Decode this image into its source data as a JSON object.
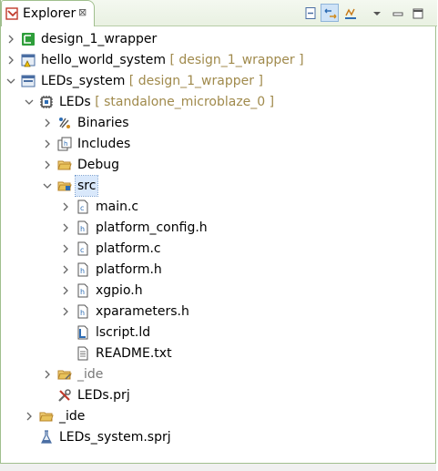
{
  "view": {
    "tab_title": "Explorer",
    "tab_close": "⊠",
    "toolbar": {
      "collapse_all": "collapse-all-icon",
      "link_with_editor": "link-with-editor-icon",
      "filter": "filter-icon",
      "view_menu": "view-menu-icon",
      "minimize": "minimize-icon",
      "maximize": "maximize-icon"
    }
  },
  "tree": {
    "design_1_wrapper": {
      "label": "design_1_wrapper"
    },
    "hello_world_system": {
      "label": "hello_world_system",
      "qualifier": "[ design_1_wrapper ]"
    },
    "leds_system": {
      "label": "LEDs_system",
      "qualifier": "[ design_1_wrapper ]"
    },
    "leds": {
      "label": "LEDs",
      "qualifier": "[ standalone_microblaze_0 ]"
    },
    "binaries": {
      "label": "Binaries"
    },
    "includes": {
      "label": "Includes"
    },
    "debug": {
      "label": "Debug"
    },
    "src": {
      "label": "src"
    },
    "main_c": {
      "label": "main.c"
    },
    "platform_config_h": {
      "label": "platform_config.h"
    },
    "platform_c": {
      "label": "platform.c"
    },
    "platform_h": {
      "label": "platform.h"
    },
    "xgpio_h": {
      "label": "xgpio.h"
    },
    "xparameters_h": {
      "label": "xparameters.h"
    },
    "lscript_ld": {
      "label": "lscript.ld"
    },
    "readme_txt": {
      "label": "README.txt"
    },
    "ide_inner": {
      "label": "_ide"
    },
    "leds_prj": {
      "label": "LEDs.prj"
    },
    "ide_outer": {
      "label": "_ide"
    },
    "leds_system_sprj": {
      "label": "LEDs_system.sprj"
    }
  },
  "colors": {
    "border": "#a0bf8e",
    "qualifier": "#a08a4c",
    "selection": "#d9e8fb",
    "folder": "#e8c25a"
  }
}
